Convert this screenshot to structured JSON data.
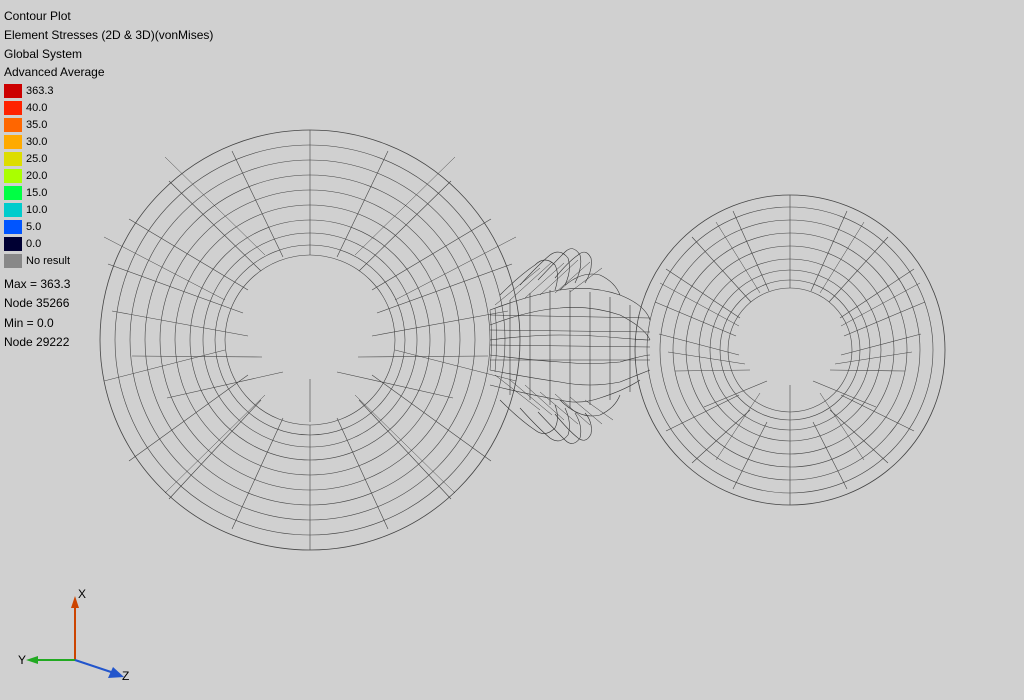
{
  "legend": {
    "title_line1": "Contour Plot",
    "title_line2": "Element Stresses (2D & 3D)(vonMises)",
    "title_line3": "Global System",
    "title_line4": "Advanced Average",
    "items": [
      {
        "value": "363.3",
        "color": "#cc0000"
      },
      {
        "value": "40.0",
        "color": "#ff2200"
      },
      {
        "value": "35.0",
        "color": "#ff6600"
      },
      {
        "value": "30.0",
        "color": "#ffaa00"
      },
      {
        "value": "25.0",
        "color": "#dddd00"
      },
      {
        "value": "20.0",
        "color": "#aaff00"
      },
      {
        "value": "15.0",
        "color": "#00ff44"
      },
      {
        "value": "10.0",
        "color": "#00cccc"
      },
      {
        "value": "5.0",
        "color": "#0055ff"
      },
      {
        "value": "0.0",
        "color": "#000033"
      }
    ],
    "no_result_label": "No result",
    "stats": {
      "max_label": "Max = 363.3",
      "node_max_label": "Node 35266",
      "min_label": "Min = 0.0",
      "node_min_label": "Node 29222"
    }
  },
  "axes": {
    "x_label": "X",
    "y_label": "Y",
    "z_label": "Z"
  }
}
